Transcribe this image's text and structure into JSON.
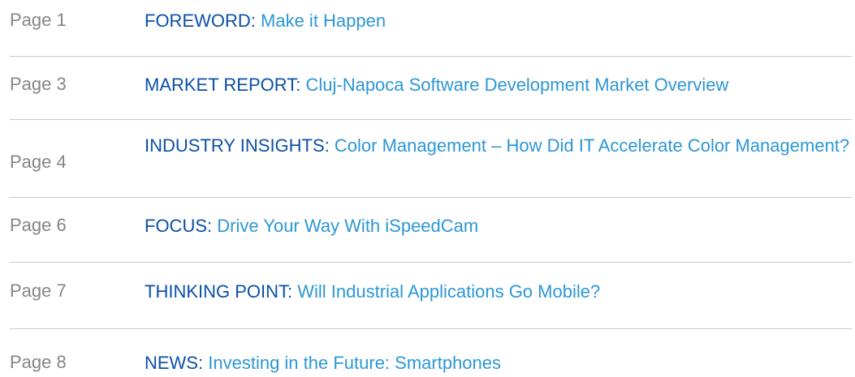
{
  "toc": {
    "entries": [
      {
        "page": "Page 1",
        "section": "FOREWORD:",
        "title": "Make it Happen"
      },
      {
        "page": "Page 3",
        "section": "MARKET REPORT:",
        "title": "Cluj-Napoca Software Development Market Overview"
      },
      {
        "page": "Page 4",
        "section": "INDUSTRY INSIGHTS:",
        "title": "Color Management – How Did IT Accelerate Color Management?"
      },
      {
        "page": "Page 6",
        "section": "FOCUS:",
        "title": "Drive Your Way With iSpeedCam"
      },
      {
        "page": "Page 7",
        "section": "THINKING POINT:",
        "title": "Will Industrial Applications Go Mobile?"
      },
      {
        "page": "Page 8",
        "section": "NEWS:",
        "title": "Investing in the Future: Smartphones"
      }
    ]
  },
  "colors": {
    "page_number": "#858585",
    "section_label": "#0a4fa8",
    "article_title": "#2c97d6",
    "divider": "#c8c8c8"
  }
}
